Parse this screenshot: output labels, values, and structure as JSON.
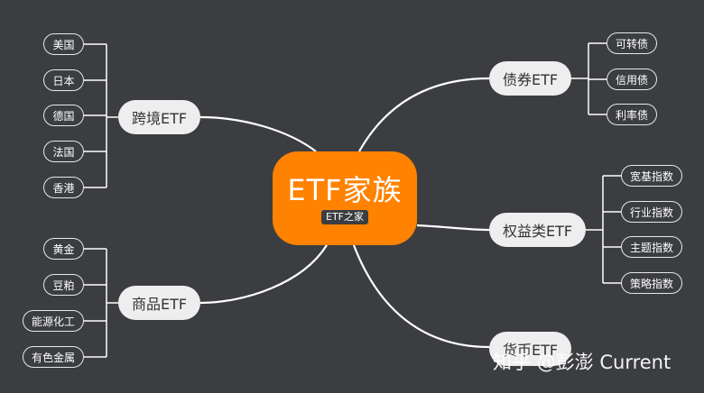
{
  "center": {
    "title": "ETF家族",
    "tag": "ETF之家"
  },
  "branches": {
    "cross_border": {
      "label": "跨境ETF",
      "leaves": [
        "美国",
        "日本",
        "德国",
        "法国",
        "香港"
      ]
    },
    "commodity": {
      "label": "商品ETF",
      "leaves": [
        "黄金",
        "豆粕",
        "能源化工",
        "有色金属"
      ]
    },
    "bond": {
      "label": "债券ETF",
      "leaves": [
        "可转债",
        "信用债",
        "利率债"
      ]
    },
    "equity": {
      "label": "权益类ETF",
      "leaves": [
        "宽基指数",
        "行业指数",
        "主题指数",
        "策略指数"
      ]
    },
    "currency": {
      "label": "货币ETF",
      "leaves": []
    }
  },
  "watermark": "知乎 @彭澎 Current",
  "colors": {
    "background": "#3b3d41",
    "center_fill": "#ff8200",
    "branch_fill": "#eeeeee",
    "line": "#ffffff"
  }
}
